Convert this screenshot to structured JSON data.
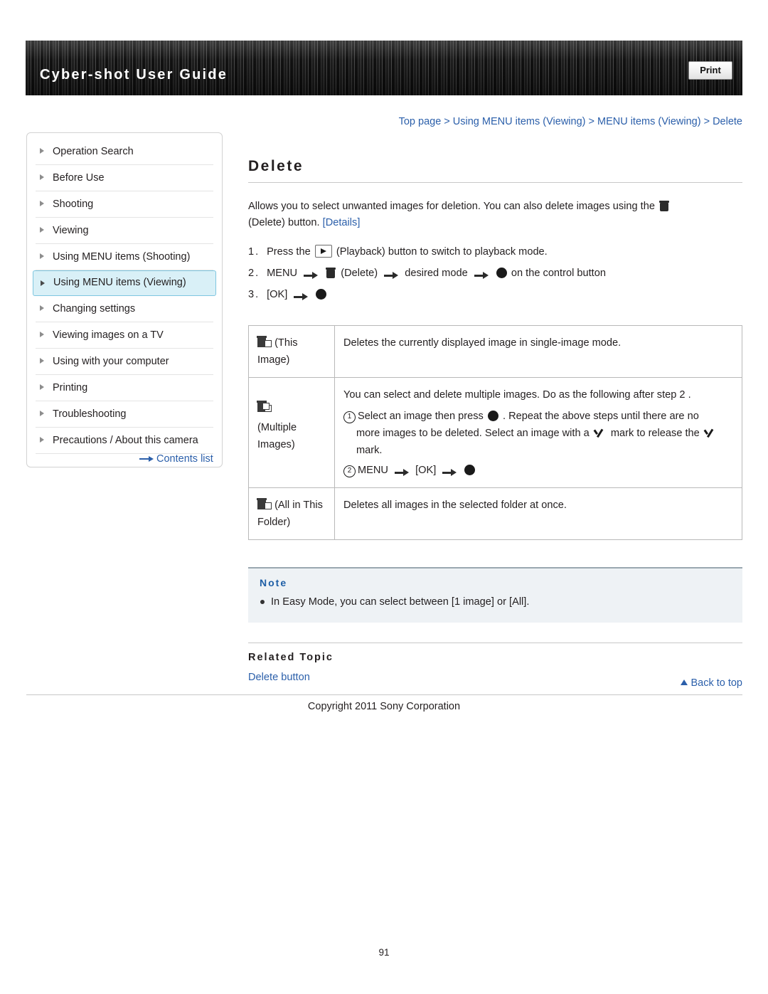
{
  "header": {
    "title": "Cyber-shot User Guide",
    "print_label": "Print"
  },
  "breadcrumb": {
    "text": "Top page > Using MENU items (Viewing) > MENU items (Viewing) > Delete"
  },
  "sidebar": {
    "items": [
      {
        "label": "Operation Search"
      },
      {
        "label": "Before Use"
      },
      {
        "label": "Shooting"
      },
      {
        "label": "Viewing"
      },
      {
        "label": "Using MENU items (Shooting)"
      },
      {
        "label": "Using MENU items (Viewing)"
      },
      {
        "label": "Changing settings"
      },
      {
        "label": "Viewing images on a TV"
      },
      {
        "label": "Using with your computer"
      },
      {
        "label": "Printing"
      },
      {
        "label": "Troubleshooting"
      },
      {
        "label": "Precautions / About this camera"
      }
    ],
    "active_index": 5,
    "contents_list_label": "Contents list"
  },
  "main": {
    "title": "Delete",
    "intro_before": "Allows you to select unwanted images for deletion. You can also delete images using the",
    "intro_after": "(Delete) button.",
    "intro_details_link": "[Details]",
    "steps": [
      {
        "num": "1.",
        "part1": "Press the",
        "part2": "(Playback) button to switch to playback mode."
      },
      {
        "num": "2.",
        "part1": "MENU",
        "part2": "(Delete)",
        "part3": "desired mode",
        "part4": "on the control button"
      },
      {
        "num": "3.",
        "part1": "[OK]"
      }
    ],
    "table": {
      "rows": [
        {
          "mode": "(This Image)",
          "desc": "Deletes the currently displayed image in single-image mode."
        },
        {
          "mode": "(Multiple Images)",
          "desc_line1": "You can select and delete multiple images. Do as the following after step 2 .",
          "desc_line2a": "Select an image then press",
          "desc_line2b": ". Repeat the above steps until there are no",
          "desc_line3a": "more images to be deleted. Select an image with a",
          "desc_line3b": "mark to release the",
          "desc_line4": "mark.",
          "desc_line5a": "MENU",
          "desc_line5b": "[OK]"
        },
        {
          "mode": "(All in This Folder)",
          "desc": "Deletes all images in the selected folder at once."
        }
      ]
    },
    "note": {
      "title": "Note",
      "items": [
        "In Easy Mode, you can select between [1 image] or [All]."
      ]
    },
    "related": {
      "title": "Related Topic",
      "link": "Delete button"
    }
  },
  "footer": {
    "back_to_top": "Back to top",
    "copyright": "Copyright 2011 Sony Corporation",
    "page_number": "91"
  }
}
